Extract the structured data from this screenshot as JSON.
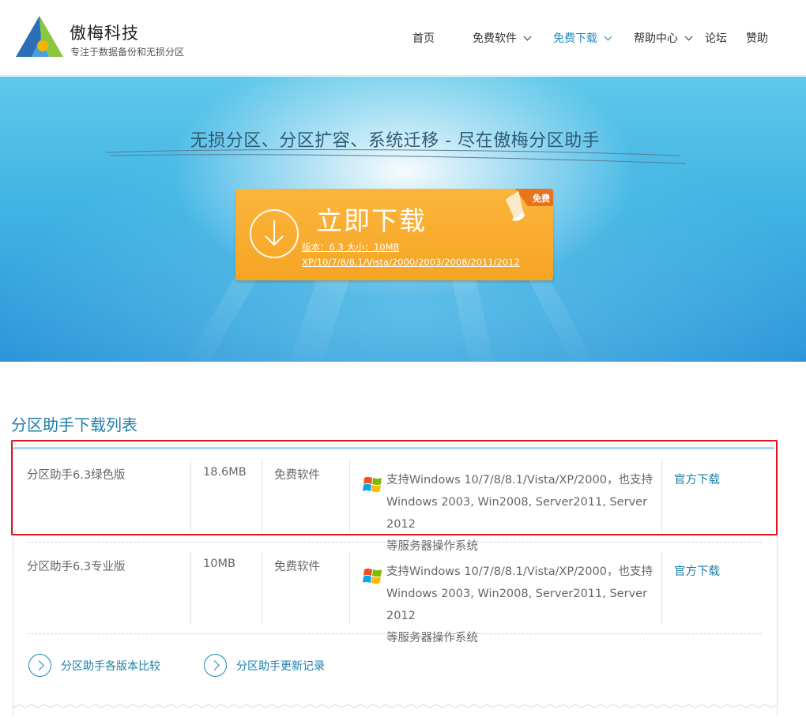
{
  "brand": {
    "name": "傲梅科技",
    "slogan": "专注于数据备份和无损分区"
  },
  "nav": {
    "items": [
      {
        "label": "首页",
        "dropdown": false,
        "active": false
      },
      {
        "label": "免费软件",
        "dropdown": true,
        "active": false
      },
      {
        "label": "免费下载",
        "dropdown": true,
        "active": true
      },
      {
        "label": "帮助中心",
        "dropdown": true,
        "active": false
      },
      {
        "label": "论坛",
        "dropdown": false,
        "active": false
      },
      {
        "label": "赞助",
        "dropdown": false,
        "active": false
      }
    ]
  },
  "banner": {
    "title": "无损分区、分区扩容、系统迁移 - 尽在傲梅分区助手",
    "download_label": "立即下载",
    "version_text": "版本：6.3 大小：10MB",
    "os_text": "XP/10/7/8/8.1/Vista/2000/2003/2008/2011/2012",
    "free_tag": "免费"
  },
  "downloads": {
    "section_title": "分区助手下载列表",
    "rows": [
      {
        "name": "分区助手6.3绿色版",
        "size": "18.6MB",
        "license": "免费软件",
        "desc_lines": [
          "支持Windows 10/7/8/8.1/Vista/XP/2000，也支持",
          "Windows 2003, Win2008, Server2011, Server 2012",
          "等服务器操作系统"
        ],
        "link": "官方下载",
        "highlighted": true
      },
      {
        "name": "分区助手6.3专业版",
        "size": "10MB",
        "license": "免费软件",
        "desc_lines": [
          "支持Windows 10/7/8/8.1/Vista/XP/2000，也支持",
          "Windows 2003, Win2008, Server2011, Server 2012",
          "等服务器操作系统"
        ],
        "link": "官方下载",
        "highlighted": false
      }
    ],
    "footer_links": [
      "分区助手各版本比较",
      "分区助手更新记录"
    ]
  },
  "colors": {
    "accent": "#1b8bc4",
    "download_button": "#f6a524",
    "highlight_border": "#e0141e"
  }
}
